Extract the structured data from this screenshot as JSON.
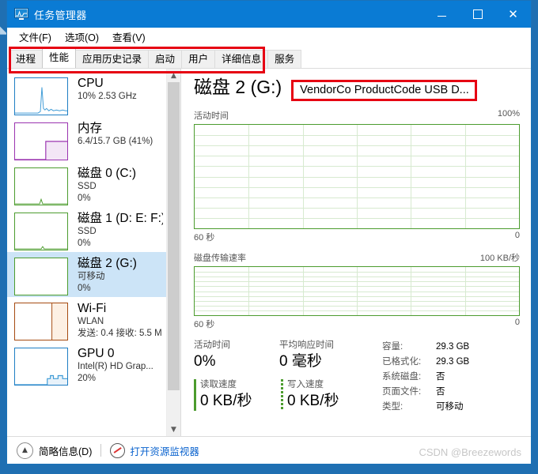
{
  "window": {
    "title": "任务管理器",
    "icon": "task-manager-icon",
    "controls": {
      "minimize": "—",
      "maximize": "□",
      "close": "✕"
    }
  },
  "menu": [
    {
      "label": "文件(F)"
    },
    {
      "label": "选项(O)"
    },
    {
      "label": "查看(V)"
    }
  ],
  "tabs": [
    {
      "label": "进程",
      "active": false
    },
    {
      "label": "性能",
      "active": true
    },
    {
      "label": "应用历史记录",
      "active": false
    },
    {
      "label": "启动",
      "active": false
    },
    {
      "label": "用户",
      "active": false
    },
    {
      "label": "详细信息",
      "active": false
    },
    {
      "label": "服务",
      "active": false
    }
  ],
  "sidebar": {
    "items": [
      {
        "title": "CPU",
        "sub1": "10% 2.53 GHz",
        "sub2": "",
        "accent": "#1f7ec4",
        "selected": false
      },
      {
        "title": "内存",
        "sub1": "6.4/15.7 GB (41%)",
        "sub2": "",
        "accent": "#9b34b0",
        "selected": false
      },
      {
        "title": "磁盘 0 (C:)",
        "sub1": "SSD",
        "sub2": "0%",
        "accent": "#4c9c2e",
        "selected": false
      },
      {
        "title": "磁盘 1 (D: E: F:)",
        "sub1": "SSD",
        "sub2": "0%",
        "accent": "#4c9c2e",
        "selected": false
      },
      {
        "title": "磁盘 2 (G:)",
        "sub1": "可移动",
        "sub2": "0%",
        "accent": "#4c9c2e",
        "selected": true
      },
      {
        "title": "Wi-Fi",
        "sub1": "WLAN",
        "sub2": "发送: 0.4 接收: 5.5 M",
        "accent": "#a64b12",
        "selected": false
      },
      {
        "title": "GPU 0",
        "sub1": "Intel(R) HD Grap...",
        "sub2": "20%",
        "accent": "#1f7ec4",
        "selected": false
      }
    ],
    "scroll_up_icon": "chevron-up-icon",
    "scroll_down_icon": "chevron-down-icon"
  },
  "main": {
    "title": "磁盘 2 (G:)",
    "device": "VendorCo ProductCode USB D...",
    "charts": [
      {
        "label": "活动时间",
        "max_label": "100%",
        "left_label": "60 秒",
        "right_label": "0"
      },
      {
        "label": "磁盘传输速率",
        "max_label": "100 KB/秒",
        "left_label": "60 秒",
        "right_label": "0"
      }
    ],
    "stats": {
      "active_time_caption": "活动时间",
      "active_time_value": "0%",
      "avg_response_caption": "平均响应时间",
      "avg_response_value": "0 毫秒",
      "read_caption": "读取速度",
      "read_value": "0 KB/秒",
      "write_caption": "写入速度",
      "write_value": "0 KB/秒"
    },
    "info": [
      {
        "key": "容量:",
        "value": "29.3 GB"
      },
      {
        "key": "已格式化:",
        "value": "29.3 GB"
      },
      {
        "key": "系统磁盘:",
        "value": "否"
      },
      {
        "key": "页面文件:",
        "value": "否"
      },
      {
        "key": "类型:",
        "value": "可移动"
      }
    ]
  },
  "statusbar": {
    "fewer_details_label": "简略信息(D)",
    "fewer_details_icon": "chevron-up-circle-icon",
    "resource_monitor_label": "打开资源监视器",
    "resource_monitor_icon": "resource-monitor-icon"
  },
  "watermark": "CSDN @Breezewords",
  "colors": {
    "titlebar": "#0a7bd4",
    "selection": "#cce4f7",
    "chart_border": "#4c9c2e",
    "chart_grid": "#d7ead0",
    "highlight": "#e60012",
    "link": "#0b63ce"
  },
  "chart_data": [
    {
      "type": "line",
      "title": "活动时间",
      "ylabel": "",
      "xlabel": "",
      "ylim": [
        0,
        100
      ],
      "ytick_labels": [
        "100%",
        "0"
      ],
      "xtick_labels": [
        "60 秒",
        "0"
      ],
      "grid": true,
      "grid_cols": 6,
      "grid_rows": 10,
      "series": [
        {
          "name": "活动时间",
          "values": [
            0,
            0,
            0,
            0,
            0,
            0,
            0,
            0,
            0,
            0,
            0,
            0,
            0,
            0,
            0,
            0,
            0,
            0,
            0,
            0
          ]
        }
      ]
    },
    {
      "type": "line",
      "title": "磁盘传输速率",
      "ylabel": "",
      "xlabel": "",
      "ylim": [
        0,
        100
      ],
      "ytick_labels": [
        "100 KB/秒",
        "0"
      ],
      "xtick_labels": [
        "60 秒",
        "0"
      ],
      "grid": true,
      "grid_cols": 6,
      "grid_rows": 10,
      "series": [
        {
          "name": "读取速度",
          "values": [
            0,
            0,
            0,
            0,
            0,
            0,
            0,
            0,
            0,
            0,
            0,
            0,
            0,
            0,
            0,
            0,
            0,
            0,
            0,
            0
          ]
        },
        {
          "name": "写入速度",
          "values": [
            0,
            0,
            0,
            0,
            0,
            0,
            0,
            0,
            0,
            0,
            0,
            0,
            0,
            0,
            0,
            0,
            0,
            0,
            0,
            0
          ]
        }
      ]
    }
  ]
}
